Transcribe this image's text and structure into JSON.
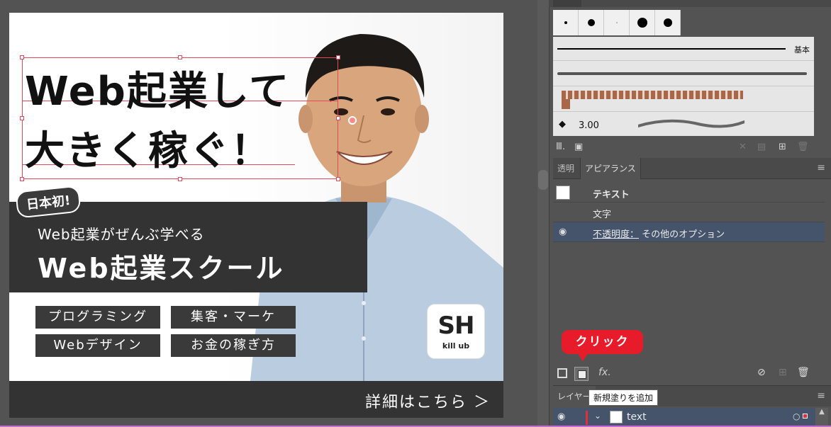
{
  "artboard": {
    "headline_line1": "Web起業して",
    "headline_line2": "大きく稼ぐ！",
    "badge": "日本初!",
    "band_sub": "Web起業がぜんぶ学べる",
    "band_main": "Web起業スクール",
    "tags": [
      "プログラミング",
      "集客・マーケ",
      "Webデザイン",
      "お金の稼ぎ方"
    ],
    "logo_main": "SH",
    "logo_sub": "kill ub",
    "cta": "詳細はこちら ＞"
  },
  "brushes": {
    "basic_label": "基本",
    "size_label": "3.00"
  },
  "appearance_panel": {
    "tabs": [
      "透明",
      "アピアランス"
    ],
    "rows": {
      "object": "テキスト",
      "characters": "文字",
      "opacity_label": "不透明度：",
      "opacity_value": "その他のオプション"
    }
  },
  "callout": "クリック",
  "tooltip": "新規塗りを追加",
  "layers_panel": {
    "tab": "レイヤー",
    "layer_name": "text"
  },
  "colors": {
    "callout_red": "#e81b2a",
    "selection_blue": "#45546b",
    "panel_bg": "#535353"
  },
  "icons": [
    "eye-icon",
    "fx-icon",
    "trash-icon",
    "clear-icon",
    "menu-icon",
    "chevron-down-icon",
    "brush-icon"
  ]
}
